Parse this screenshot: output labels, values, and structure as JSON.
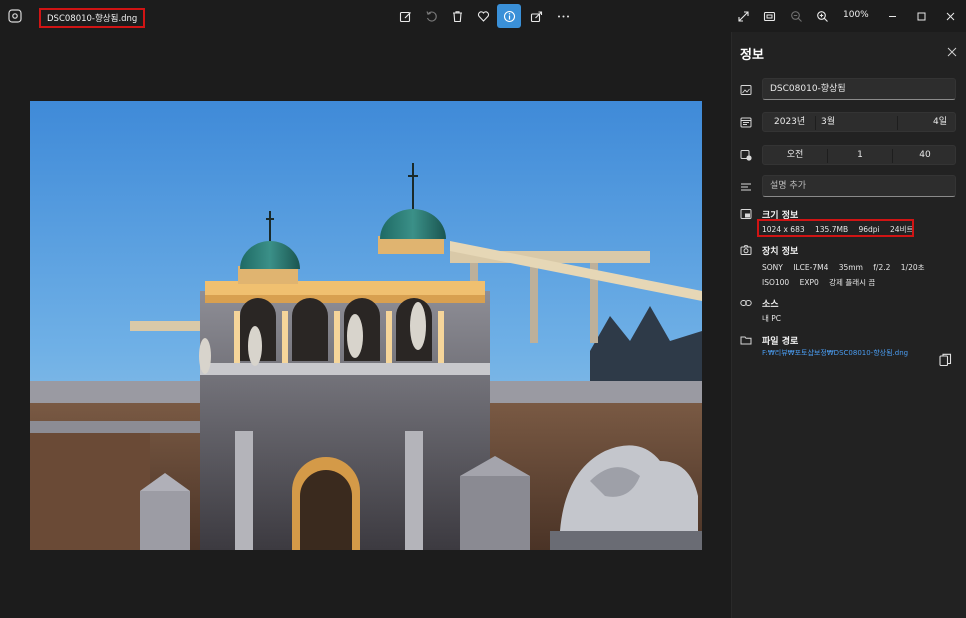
{
  "title_bar": {
    "filename": "DSC08010-향상됨.dng",
    "zoom_level": "100%"
  },
  "toolbar": {
    "icons": [
      "edit-image-icon",
      "rotate-icon",
      "delete-icon",
      "favorite-heart-icon",
      "info-icon",
      "share-icon",
      "more-icon"
    ],
    "active": "info-icon"
  },
  "window": {
    "icons": [
      "fullscreen-icon",
      "fit-window-icon",
      "zoom-out-icon",
      "zoom-in-icon",
      "minimize-icon",
      "maximize-icon",
      "close-icon"
    ]
  },
  "info_panel": {
    "title": "정보",
    "filename_field": "DSC08010-향상됨",
    "date": {
      "year": "2023년",
      "month": "3월",
      "day": "4일"
    },
    "time": {
      "ampm": "오전",
      "hour": "1",
      "minute": "40"
    },
    "description_placeholder": "설명 추가",
    "size_info": {
      "title": "크기 정보",
      "dimensions": "1024 x 683",
      "file_size": "135.7MB",
      "dpi": "96dpi",
      "bit_depth": "24비트"
    },
    "device_info": {
      "title": "장치 정보",
      "maker": "SONY",
      "model": "ILCE-7M4",
      "focal": "35mm",
      "aperture": "f/2.2",
      "shutter": "1/20초",
      "iso": "ISO100",
      "exposure": "EXP0",
      "flash": "강제 플래시 끔"
    },
    "source": {
      "title": "소스",
      "value": "내 PC"
    },
    "file_path": {
      "title": "파일 경로",
      "value": "F:₩리뷰₩포토샵보정₩DSC08010-향상됨.dng"
    }
  },
  "colors": {
    "accent": "#3a90d8",
    "highlight_box": "#d01414",
    "link": "#4a9cf0",
    "background": "#1c1c1c",
    "panel": "#222222"
  }
}
